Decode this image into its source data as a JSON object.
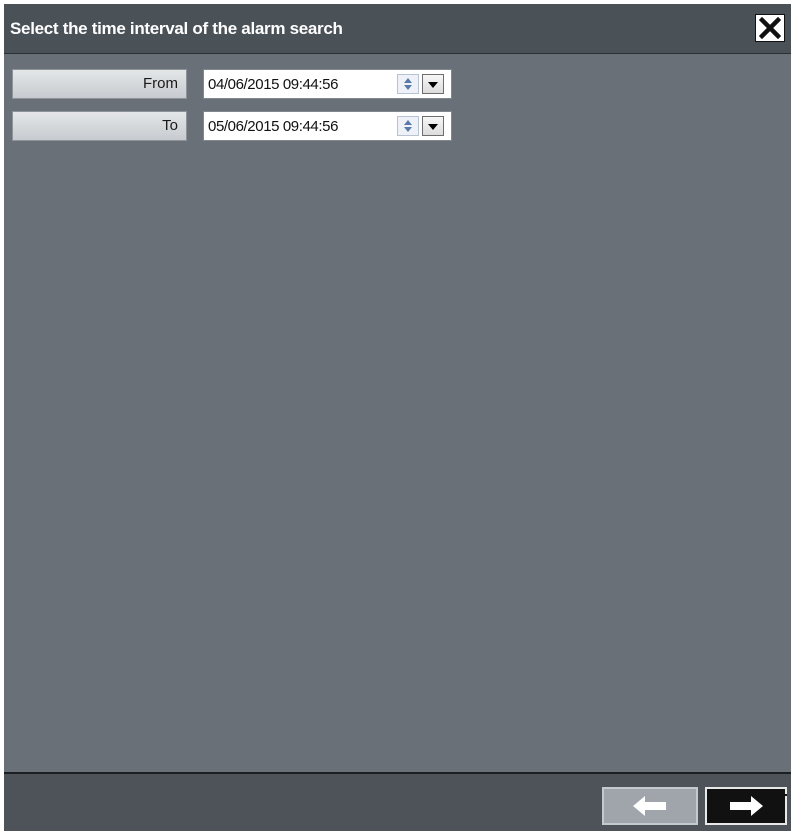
{
  "dialog": {
    "title": "Select the time interval of the alarm search",
    "close_icon": "close-icon"
  },
  "fields": [
    {
      "label": "From",
      "value": "04/06/2015 09:44:56"
    },
    {
      "label": "To",
      "value": "05/06/2015 09:44:56"
    }
  ],
  "footer": {
    "back_icon": "arrow-left-icon",
    "back_enabled": false,
    "next_icon": "arrow-right-icon",
    "next_enabled": true
  },
  "colors": {
    "background": "#697078",
    "titlebar": "#4a5157",
    "footer": "#4d5359"
  }
}
